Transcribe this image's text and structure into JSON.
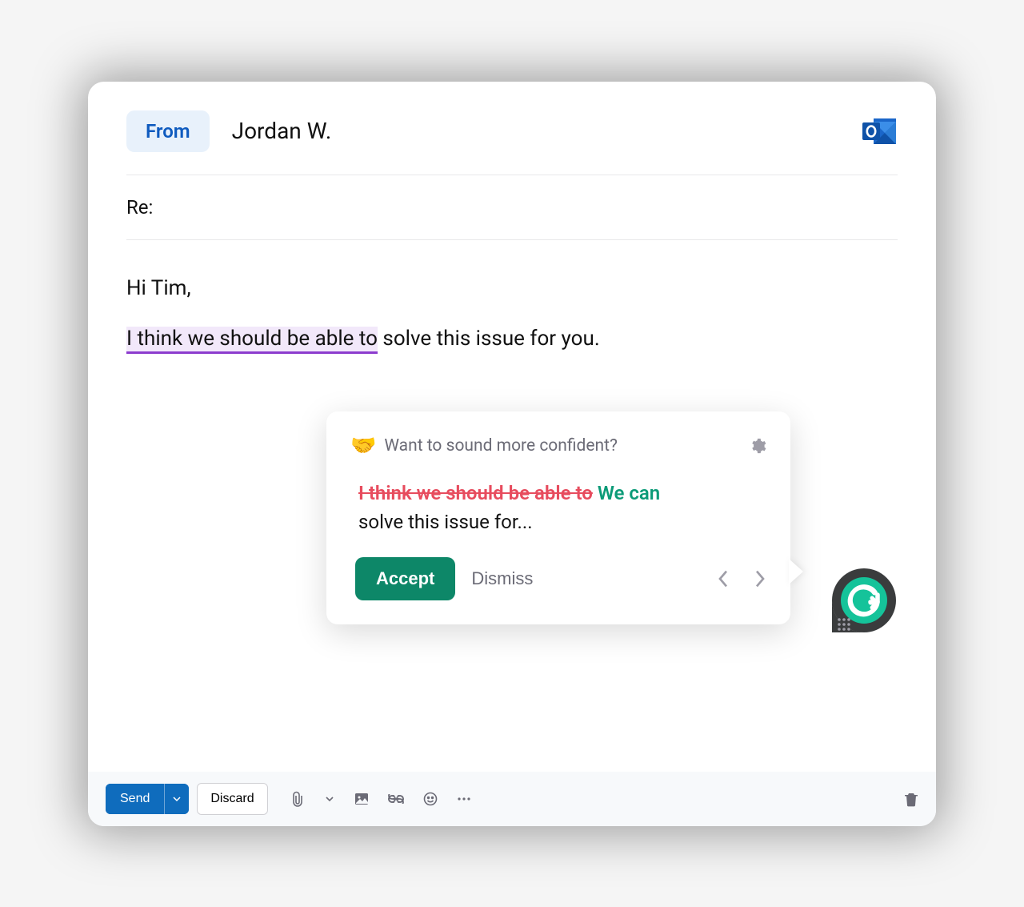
{
  "header": {
    "from_label": "From",
    "from_value": "Jordan W.",
    "app_icon": "outlook-icon"
  },
  "subject": {
    "prefix": "Re:"
  },
  "body": {
    "greeting": "Hi Tim,",
    "highlighted_text": "I think we should be able to",
    "rest_text": " solve this issue for you."
  },
  "popup": {
    "emoji": "🤝",
    "title": "Want to sound more confident?",
    "strike_text": "I think we should be able to",
    "replacement_text": "We can",
    "suggestion_rest": "solve this issue for...",
    "accept_label": "Accept",
    "dismiss_label": "Dismiss"
  },
  "footer": {
    "send_label": "Send",
    "discard_label": "Discard"
  },
  "colors": {
    "primary_blue": "#0f6cbd",
    "grammarly_green": "#15c39a",
    "strike_red": "#e74c5e",
    "replacement_green": "#0b9b78",
    "highlight_purple": "#8c3cce"
  }
}
